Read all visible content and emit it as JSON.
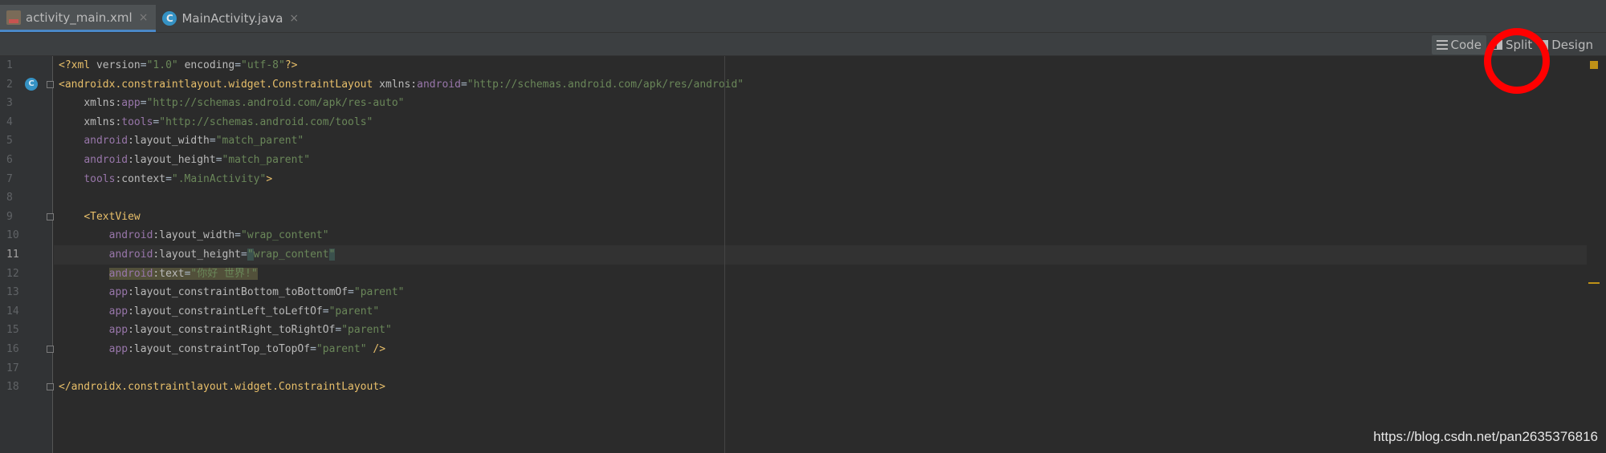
{
  "tabs": [
    {
      "label": "activity_main.xml",
      "icon": "xml-file-icon",
      "active": true
    },
    {
      "label": "MainActivity.java",
      "icon": "java-class-icon",
      "active": false
    }
  ],
  "tab_close_glyph": "×",
  "java_badge_letter": "C",
  "modes": {
    "code_label": "Code",
    "split_label": "Split",
    "design_label": "Design",
    "selected": "Code"
  },
  "gutter_badge_letter": "C",
  "current_line": 11,
  "lines": [
    {
      "n": "1"
    },
    {
      "n": "2"
    },
    {
      "n": "3"
    },
    {
      "n": "4"
    },
    {
      "n": "5"
    },
    {
      "n": "6"
    },
    {
      "n": "7"
    },
    {
      "n": "8"
    },
    {
      "n": "9"
    },
    {
      "n": "10"
    },
    {
      "n": "11"
    },
    {
      "n": "12"
    },
    {
      "n": "13"
    },
    {
      "n": "14"
    },
    {
      "n": "15"
    },
    {
      "n": "16"
    },
    {
      "n": "17"
    },
    {
      "n": "18"
    }
  ],
  "code": {
    "l1": {
      "open": "<?xml ",
      "a1": "version",
      "eq1": "=",
      "v1": "\"1.0\"",
      "sp": " ",
      "a2": "encoding",
      "eq2": "=",
      "v2": "\"utf-8\"",
      "close": "?>"
    },
    "l2": {
      "tag": "<androidx.constraintlayout.widget.ConstraintLayout",
      "sp": " ",
      "attr": "xmlns:",
      "ns": "android",
      "eq": "=",
      "val": "\"http://schemas.android.com/apk/res/android\""
    },
    "l3": {
      "indent": "    ",
      "attr": "xmlns:",
      "ns": "app",
      "eq": "=",
      "val": "\"http://schemas.android.com/apk/res-auto\""
    },
    "l4": {
      "indent": "    ",
      "attr": "xmlns:",
      "ns": "tools",
      "eq": "=",
      "val": "\"http://schemas.android.com/tools\""
    },
    "l5": {
      "indent": "    ",
      "ns": "android",
      "attr": ":layout_width",
      "eq": "=",
      "val": "\"match_parent\""
    },
    "l6": {
      "indent": "    ",
      "ns": "android",
      "attr": ":layout_height",
      "eq": "=",
      "val": "\"match_parent\""
    },
    "l7": {
      "indent": "    ",
      "ns": "tools",
      "attr": ":context",
      "eq": "=",
      "val": "\".MainActivity\"",
      "close": ">"
    },
    "l9": {
      "indent": "    ",
      "tag": "<TextView"
    },
    "l10": {
      "indent": "        ",
      "ns": "android",
      "attr": ":layout_width",
      "eq": "=",
      "val": "\"wrap_content\""
    },
    "l11": {
      "indent": "        ",
      "ns": "android",
      "attr": ":layout_height",
      "eq": "=",
      "q1": "\"",
      "val": "wrap_content",
      "q2": "\""
    },
    "l12": {
      "indent": "        ",
      "ns": "android",
      "attr": ":text",
      "eq": "=",
      "val": "\"你好 世界!\""
    },
    "l13": {
      "indent": "        ",
      "ns": "app",
      "attr": ":layout_constraintBottom_toBottomOf",
      "eq": "=",
      "val": "\"parent\""
    },
    "l14": {
      "indent": "        ",
      "ns": "app",
      "attr": ":layout_constraintLeft_toLeftOf",
      "eq": "=",
      "val": "\"parent\""
    },
    "l15": {
      "indent": "        ",
      "ns": "app",
      "attr": ":layout_constraintRight_toRightOf",
      "eq": "=",
      "val": "\"parent\""
    },
    "l16": {
      "indent": "        ",
      "ns": "app",
      "attr": ":layout_constraintTop_toTopOf",
      "eq": "=",
      "val": "\"parent\"",
      "close": " />"
    },
    "l18": {
      "tag": "</androidx.constraintlayout.widget.ConstraintLayout>"
    }
  },
  "watermark": "https://blog.csdn.net/pan2635376816",
  "colors": {
    "tag": "#e8bf6a",
    "namespace": "#9876aa",
    "value": "#6a8759",
    "attribute": "#bababa",
    "annotation": "#ff0000"
  }
}
